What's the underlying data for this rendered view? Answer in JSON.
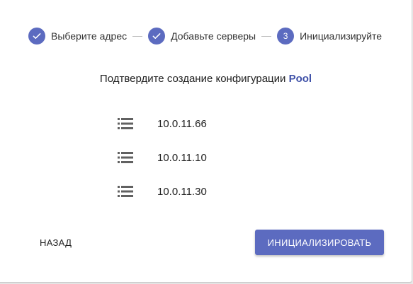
{
  "stepper": {
    "steps": [
      {
        "label": "Выберите адрес",
        "state": "done",
        "icon": "check-icon"
      },
      {
        "label": "Добавьте серверы",
        "state": "done",
        "icon": "check-icon"
      },
      {
        "label": "Инициализируйте",
        "state": "active",
        "number": "3"
      }
    ]
  },
  "confirm": {
    "prefix": "Подтвердите создание конфигурации",
    "pool_name": "Pool"
  },
  "servers": [
    {
      "icon": "server-list-icon",
      "ip": "10.0.11.66"
    },
    {
      "icon": "server-list-icon",
      "ip": "10.0.11.10"
    },
    {
      "icon": "server-list-icon",
      "ip": "10.0.11.30"
    }
  ],
  "actions": {
    "back_label": "НАЗАД",
    "initialize_label": "ИНИЦИАЛИЗИРОВАТЬ"
  },
  "colors": {
    "accent": "#5c6bc0",
    "pool_text": "#3f51a8",
    "icon_gray": "#616161"
  }
}
